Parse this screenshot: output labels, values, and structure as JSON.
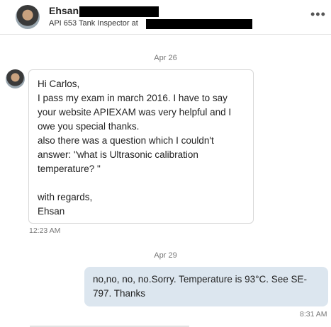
{
  "header": {
    "name": "Ehsan",
    "subtitle": "API 653 Tank Inspector at",
    "more_icon": "more-horizontal-icon"
  },
  "thread": {
    "date_1": "Apr 26",
    "message_1": {
      "text": "Hi Carlos,\nI pass my exam in march 2016. I have to say your website APIEXAM was very helpful and I owe you special thanks.\nalso there was a question which I couldn't answer: \"what is Ultrasonic calibration temperature? \"\n\nwith regards,\nEhsan",
      "time": "12:23 AM"
    },
    "date_2": "Apr 29",
    "message_2": {
      "text": "no,no, no, no.Sorry. Temperature is 93°C. See SE-797. Thanks",
      "time": "8:31 AM"
    }
  },
  "colors": {
    "outgoing_bubble": "#dce6ef",
    "incoming_border": "#d8d8d8",
    "meta_text": "#777777"
  }
}
